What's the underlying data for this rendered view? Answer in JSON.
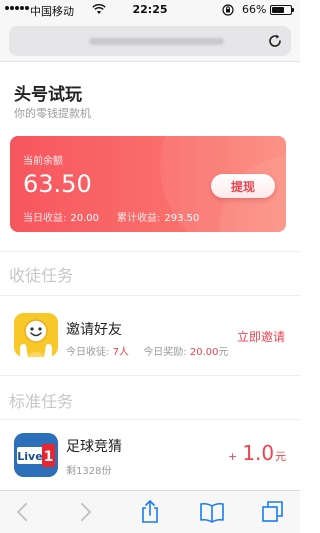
{
  "status_bar": {
    "carrier": "中国移动",
    "time": "22:25",
    "battery_percent": "66%",
    "battery_level": 0.66
  },
  "browser": {
    "url_blurred": true,
    "icons": {
      "reload": "reload-icon",
      "back": "back-arrow-icon",
      "forward": "forward-arrow-icon",
      "share": "share-icon",
      "bookmarks": "bookmarks-icon",
      "tabs": "tabs-icon"
    }
  },
  "header": {
    "title": "头号试玩",
    "subtitle": "你的零钱提款机"
  },
  "balance_card": {
    "label": "当前余额",
    "value": "63.50",
    "withdraw_label": "提现",
    "today_label": "当日收益:",
    "today_value": "20.00",
    "total_label": "累计收益:",
    "total_value": "293.50",
    "colors": {
      "gradient_start": "#f7565e",
      "gradient_end": "#fb8a7c"
    }
  },
  "sections": {
    "apprentice_title": "收徒任务",
    "standard_title": "标准任务"
  },
  "invite_task": {
    "name": "邀请好友",
    "today_apprentices_label": "今日收徒:",
    "today_apprentices_value": "7人",
    "today_reward_label": "今日奖励:",
    "today_reward_value": "20.00",
    "today_reward_unit": "元",
    "action_label": "立即邀请",
    "icon": "smiley-face-icon"
  },
  "standard_task": {
    "name": "足球竞猜",
    "remaining": "剩1328份",
    "reward_sign": "+",
    "reward_value": "1.0",
    "reward_unit": "元",
    "icon_text_1": "Live",
    "icon_text_2": "1"
  },
  "colors": {
    "accent": "#f0434e",
    "muted": "#9a9a9a",
    "section_title": "#c7c7c7"
  }
}
